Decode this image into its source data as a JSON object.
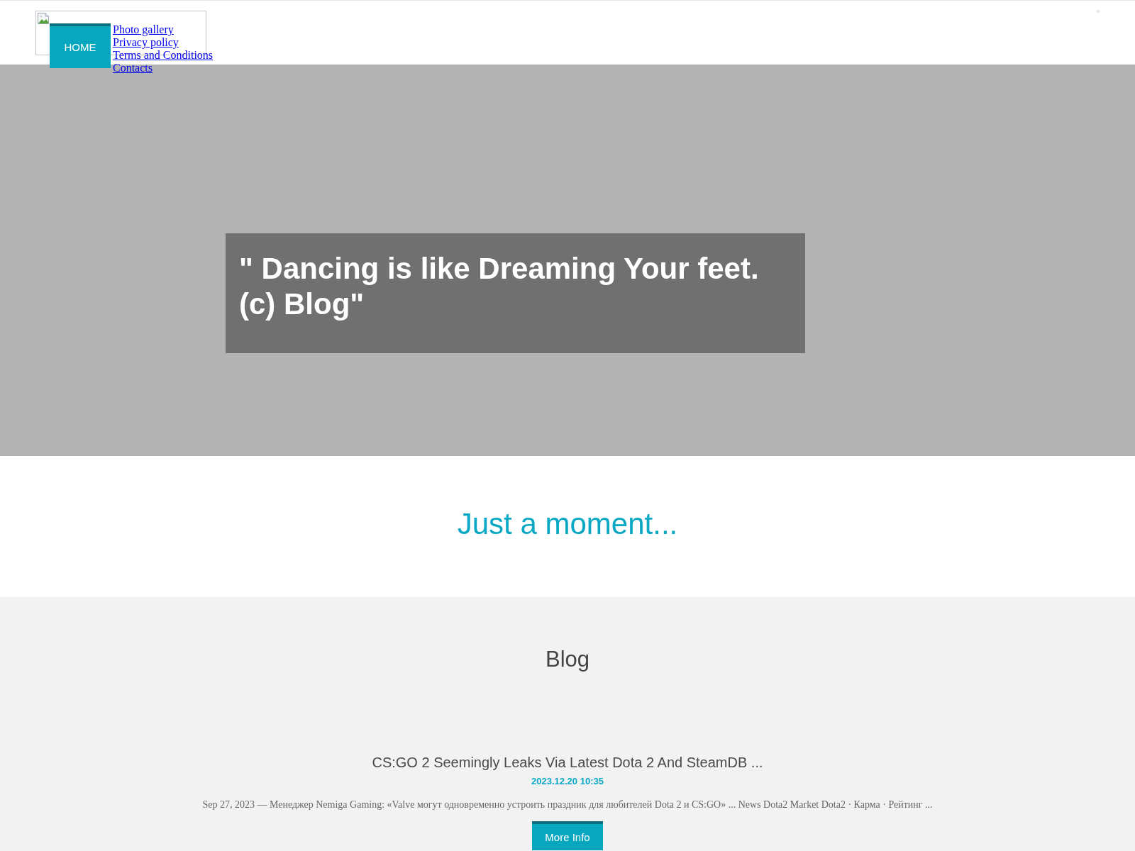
{
  "nav": [
    {
      "label": "HOME",
      "kind": "button"
    },
    {
      "label": "Photo gallery",
      "kind": "link"
    },
    {
      "label": "Privacy policy",
      "kind": "link"
    },
    {
      "label": "Terms and Conditions",
      "kind": "link"
    },
    {
      "label": "Contacts",
      "kind": "link"
    }
  ],
  "hero": {
    "quote": "\" Dancing is like Dreaming Your feet. (c) Blog\""
  },
  "notice": {
    "heading": "Just a moment..."
  },
  "blog": {
    "heading": "Blog",
    "posts": [
      {
        "title": "CS:GO 2 Seemingly Leaks Via Latest Dota 2 And SteamDB ...",
        "date": "2023.12.20 10:35",
        "summary": "Sep 27, 2023 — Менеджер Nemiga Gaming: «Valve могут одновременно устроить праздник для любителей Dota 2 и CS:GO» ... News Dota2 Market Dota2 · Карма · Рейтинг ...",
        "button": "More Info"
      }
    ]
  }
}
